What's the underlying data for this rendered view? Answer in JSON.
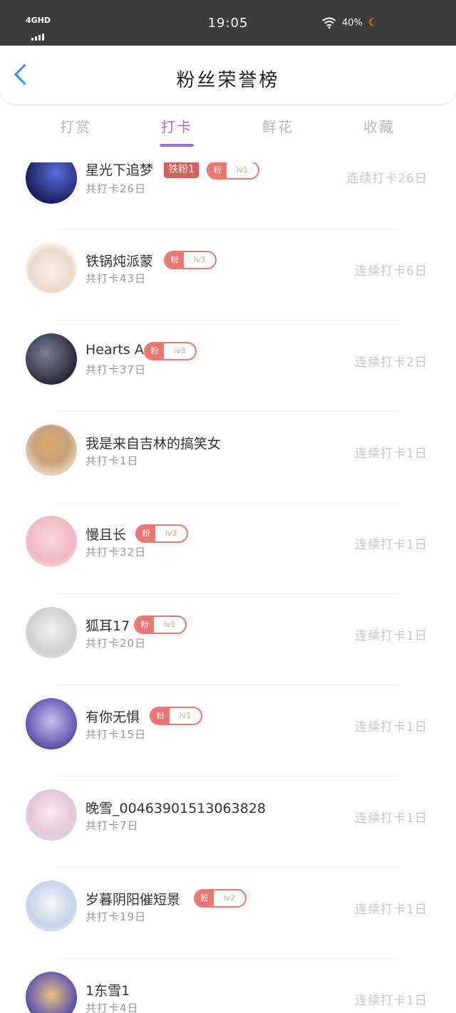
{
  "status": {
    "network": "4GHD",
    "time": "19:05",
    "battery": "40%"
  },
  "header": {
    "title": "粉丝荣誉榜"
  },
  "tabs": [
    {
      "label": "打赏",
      "active": false
    },
    {
      "label": "打卡",
      "active": true
    },
    {
      "label": "鲜花",
      "active": false
    },
    {
      "label": "收藏",
      "active": false
    }
  ],
  "colors": {
    "accent": "#a06fe0",
    "back": "#2c9bf0",
    "badge": "#ef7670"
  },
  "fans": [
    {
      "name": "星光下追梦",
      "tag": "铁粉1",
      "fan_label": "粉",
      "level": "lv1",
      "total": "共打卡26日",
      "streak": "连续打卡26日"
    },
    {
      "name": "铁锅炖派蒙",
      "tag": "",
      "fan_label": "粉",
      "level": "lv3",
      "total": "共打卡43日",
      "streak": "连续打卡6日"
    },
    {
      "name": "Hearts A",
      "tag": "",
      "fan_label": "粉",
      "level": "lv3",
      "total": "共打卡37日",
      "streak": "连续打卡2日"
    },
    {
      "name": "我是来自吉林的搞笑女",
      "tag": "",
      "fan_label": "",
      "level": "",
      "total": "共打卡1日",
      "streak": "连续打卡1日"
    },
    {
      "name": "慢且长",
      "tag": "",
      "fan_label": "粉",
      "level": "lv3",
      "total": "共打卡32日",
      "streak": "连续打卡1日"
    },
    {
      "name": "狐耳17",
      "tag": "",
      "fan_label": "粉",
      "level": "lv1",
      "total": "共打卡20日",
      "streak": "连续打卡1日"
    },
    {
      "name": "有你无惧",
      "tag": "",
      "fan_label": "粉",
      "level": "lv1",
      "total": "共打卡15日",
      "streak": "连续打卡1日"
    },
    {
      "name": "晚雪_004639015130638​28",
      "tag": "",
      "fan_label": "",
      "level": "",
      "total": "共打卡7日",
      "streak": "连续打卡1日"
    },
    {
      "name": "岁暮阴阳催短景",
      "tag": "",
      "fan_label": "粉",
      "level": "lv2",
      "total": "共打卡19日",
      "streak": "连续打卡1日"
    },
    {
      "name": "1东雪1",
      "tag": "",
      "fan_label": "",
      "level": "",
      "total": "共打卡4日",
      "streak": "连续打卡1日"
    }
  ]
}
